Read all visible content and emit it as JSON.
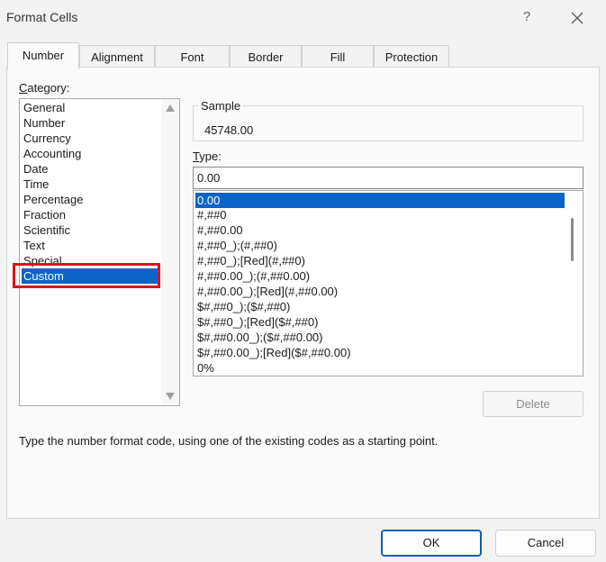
{
  "window": {
    "title": "Format Cells",
    "help_label": "?",
    "close_icon": "close-icon"
  },
  "tabs": [
    {
      "label": "Number",
      "active": true
    },
    {
      "label": "Alignment"
    },
    {
      "label": "Font"
    },
    {
      "label": "Border"
    },
    {
      "label": "Fill"
    },
    {
      "label": "Protection"
    }
  ],
  "category": {
    "label_first": "C",
    "label_rest": "ategory:",
    "items": [
      "General",
      "Number",
      "Currency",
      "Accounting",
      "Date",
      "Time",
      "Percentage",
      "Fraction",
      "Scientific",
      "Text",
      "Special",
      "Custom"
    ],
    "selected": "Custom"
  },
  "sample": {
    "label": "Sample",
    "value": "45748.00"
  },
  "type": {
    "label_first": "T",
    "label_rest": "ype:",
    "value": "0.00",
    "items": [
      "0.00",
      "#,##0",
      "#,##0.00",
      "#,##0_);(#,##0)",
      "#,##0_);[Red](#,##0)",
      "#,##0.00_);(#,##0.00)",
      "#,##0.00_);[Red](#,##0.00)",
      "$#,##0_);($#,##0)",
      "$#,##0_);[Red]($#,##0)",
      "$#,##0.00_);($#,##0.00)",
      "$#,##0.00_);[Red]($#,##0.00)",
      "0%"
    ]
  },
  "buttons": {
    "delete": "Delete",
    "ok": "OK",
    "cancel": "Cancel"
  },
  "hint": "Type the number format code, using one of the existing codes as a starting point.",
  "colors": {
    "selection": "#0a64c8",
    "highlight_box": "#e0101e",
    "ok_border": "#0a5fb8"
  }
}
